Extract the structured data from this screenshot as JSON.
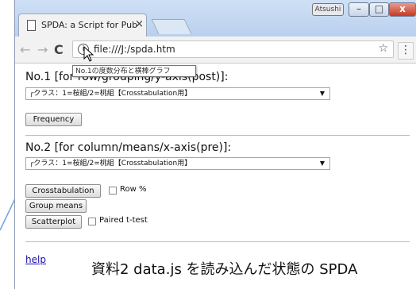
{
  "browser": {
    "tab_title": "SPDA: a Script for Pub",
    "tab_close": "×",
    "profile_name": "Atsushi",
    "window_controls": {
      "minimize": "–",
      "maximize": "□",
      "close": "x"
    },
    "url": "file:///J:/spda.htm",
    "star": "☆",
    "menu": "⋮"
  },
  "section1": {
    "label": "No.1 [for row/grouping/y-axis(post)]:",
    "select_value": "┌クラス：1=桜組/2=桃組【Crosstabulation用】",
    "frequency_button": "Frequency",
    "tooltip": "No.1の度数分布と横棒グラフ"
  },
  "section2": {
    "label": "No.2 [for column/means/x-axis(pre)]:",
    "select_value": "┌クラス：1=桜組/2=桃組【Crosstabulation用】",
    "crosstab_button": "Crosstabulation",
    "row_pct_label": "Row %",
    "group_means_button": "Group means",
    "scatterplot_button": "Scatterplot",
    "paired_t_label": "Paired t-test"
  },
  "footer": {
    "help_link": "help",
    "caption": "資料2 data.js を読み込んだ状態の SPDA"
  },
  "colors": {
    "titlebar": "#c3d7f0",
    "link": "#1a0dab",
    "close_button": "#c43b23"
  }
}
